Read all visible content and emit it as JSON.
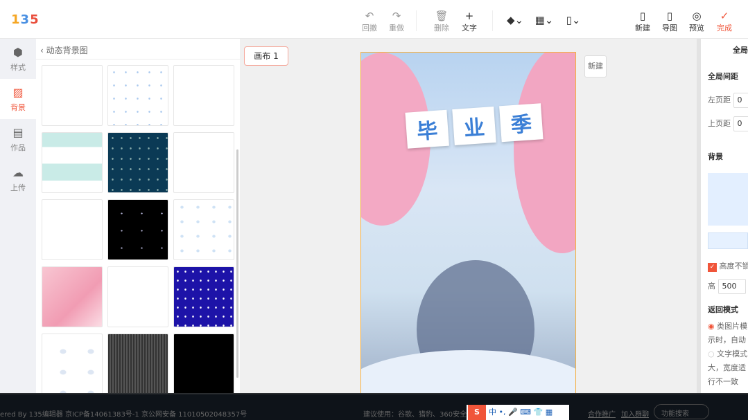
{
  "header": {
    "logo": [
      "1",
      "3",
      "5"
    ],
    "toolbar": [
      {
        "label": "回撤",
        "icon": "undo-icon"
      },
      {
        "label": "重做",
        "icon": "redo-icon"
      },
      {
        "label": "删除",
        "icon": "trash-icon"
      },
      {
        "label": "文字",
        "icon": "plus-icon"
      },
      {
        "label": "新建",
        "icon": "file-icon"
      },
      {
        "label": "导图",
        "icon": "image-file-icon"
      },
      {
        "label": "预览",
        "icon": "eye-icon"
      },
      {
        "label": "完成",
        "icon": "check-icon"
      }
    ]
  },
  "rail": [
    {
      "label": "样式"
    },
    {
      "label": "背景"
    },
    {
      "label": "作品"
    },
    {
      "label": "上传"
    }
  ],
  "panel": {
    "back_title": "动态背景图"
  },
  "canvas": {
    "tab": "画布 1",
    "new_button": "新建",
    "poster_title": [
      "毕",
      "业",
      "季"
    ]
  },
  "right": {
    "tab": "全局",
    "spacing_heading": "全局间距",
    "left_margin_label": "左页距",
    "left_margin": "0",
    "top_margin_label": "上页距",
    "top_margin": "0",
    "bg_heading": "背景",
    "height_check": "高度不锁",
    "height_label": "高",
    "height": "500",
    "mode_heading": "返回模式",
    "mode1": "类图片模",
    "mode1_desc": "示时，自动",
    "mode2": "文字模式",
    "mode2_desc": "大，宽度适",
    "mode2_desc2": "行不一致"
  },
  "footer": {
    "left": "ered By 135编辑器 京ICP备14061383号-1 京公网安备 11010502048357号",
    "middle": "建议使用：谷歌、猎豹、360安全浏",
    "ime": "中 •, 🎤 ⌨ 👕 ▦",
    "link1": "合作推广",
    "link2": "加入群聊",
    "search": "功能搜索"
  },
  "colors": {
    "accent": "#f0553a"
  }
}
